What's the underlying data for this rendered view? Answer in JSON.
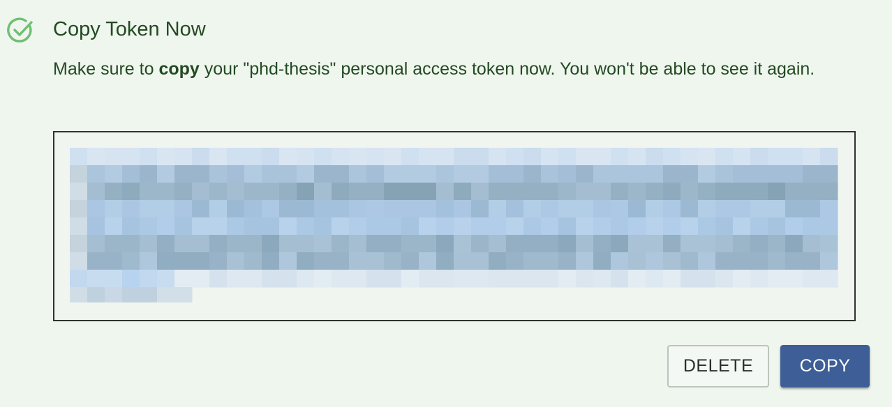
{
  "dialog": {
    "title": "Copy Token Now",
    "message": {
      "before": "Make sure to ",
      "bold": "copy",
      "after": " your \"phd-thesis\" personal access token now. You won't be able to see it again."
    },
    "token_state": "redacted-pixelated"
  },
  "buttons": {
    "delete_label": "DELETE",
    "copy_label": "COPY"
  },
  "icons": {
    "status": "check-circle-icon"
  },
  "colors": {
    "background": "#eff6ee",
    "text": "#234a23",
    "check_icon": "#6fbf73",
    "copy_button": "#3d5e96",
    "token_border": "#2e332e"
  }
}
